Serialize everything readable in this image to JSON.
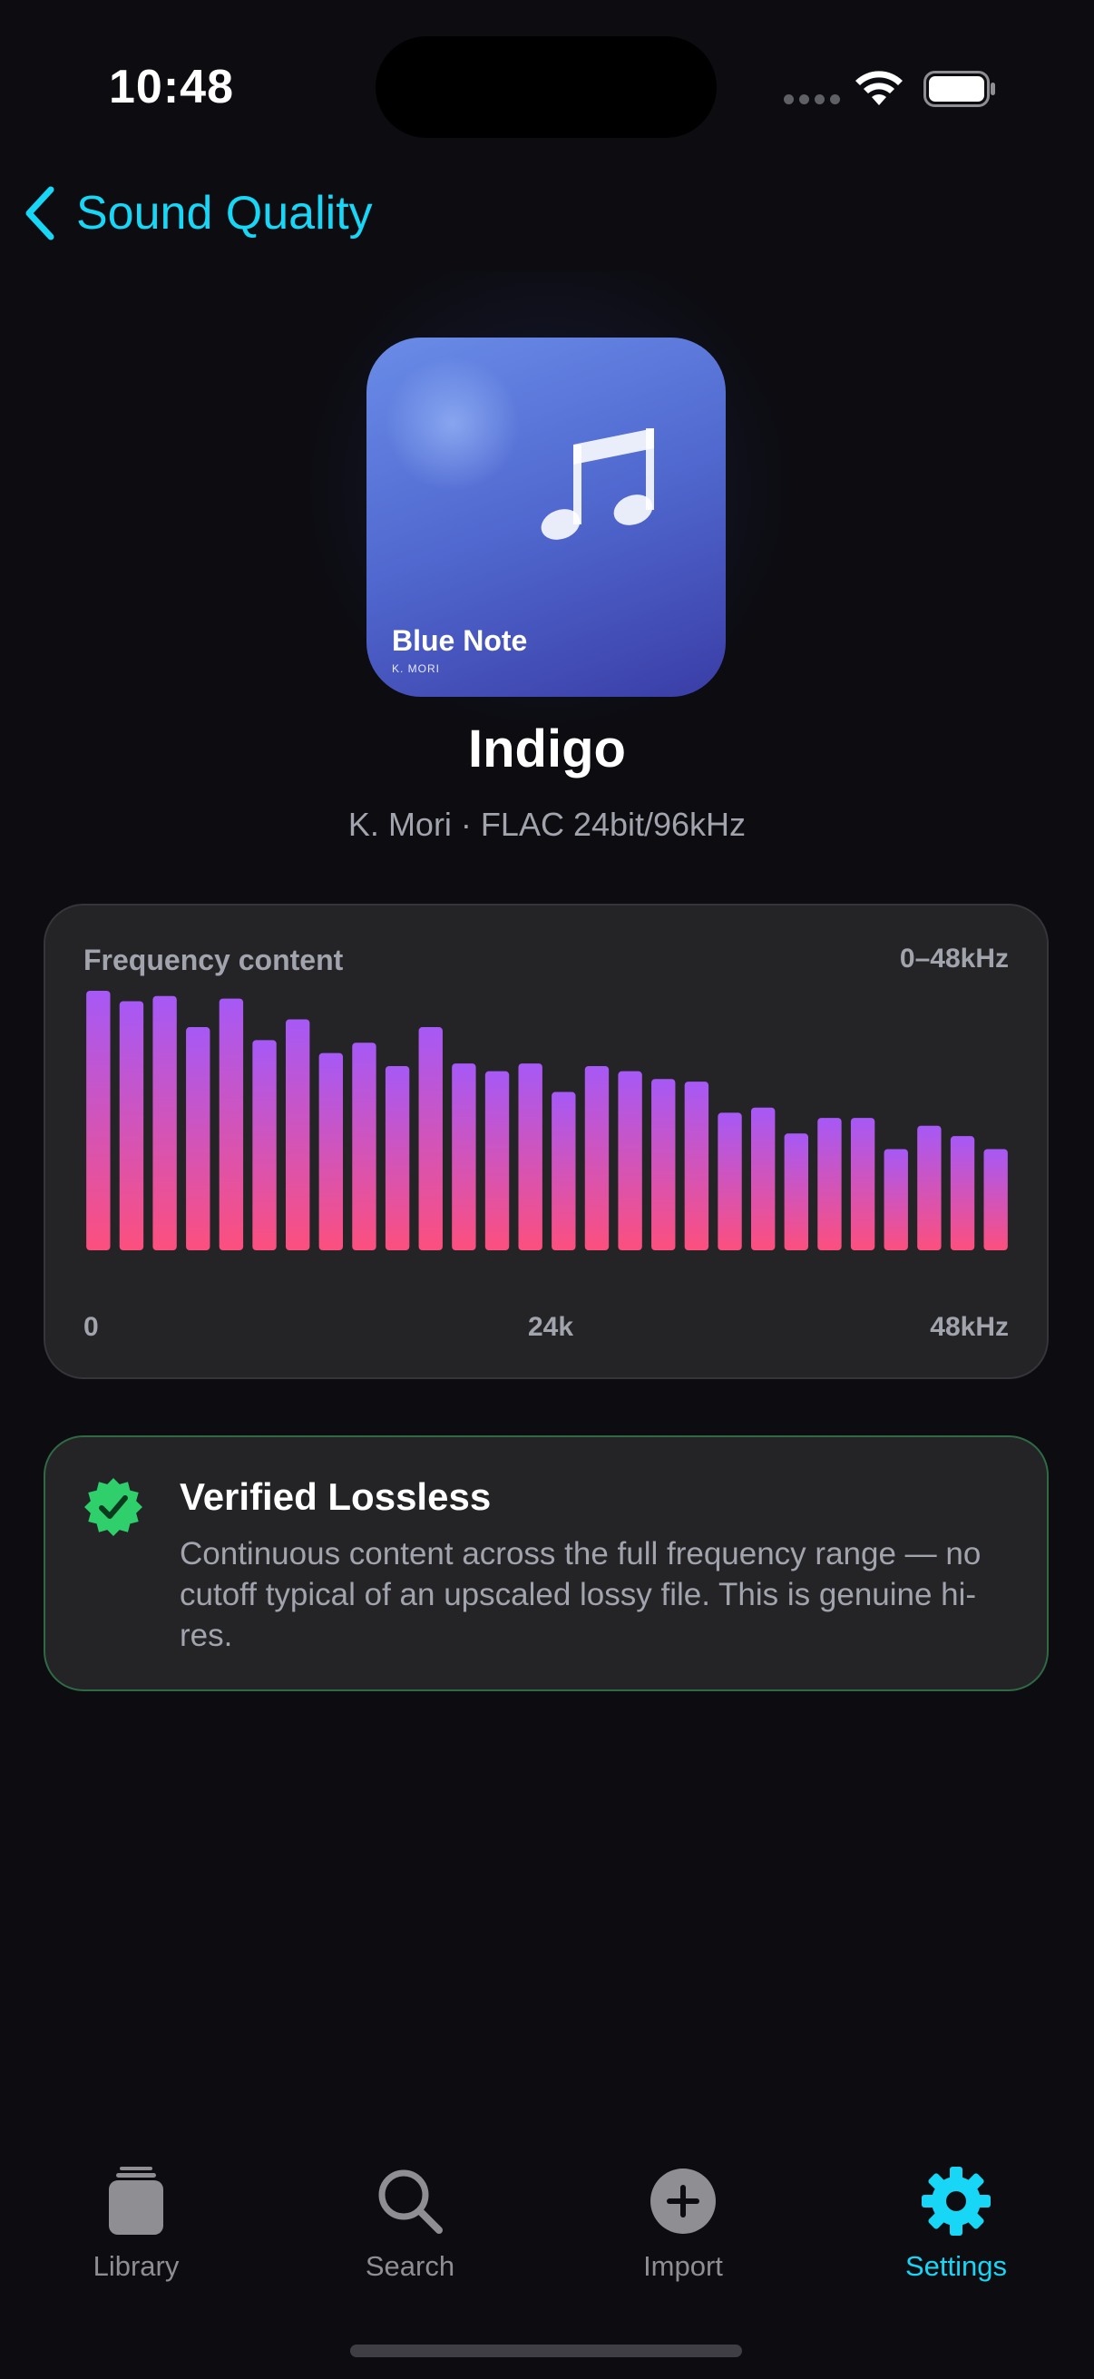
{
  "status_bar": {
    "time": "10:48"
  },
  "nav": {
    "back_label": "Sound Quality"
  },
  "album": {
    "art_title": "Blue Note",
    "art_artist": "K. MORI"
  },
  "track": {
    "title": "Indigo",
    "subtitle": "K. Mori · FLAC 24bit/96kHz"
  },
  "frequency": {
    "title": "Frequency content",
    "range_label": "0–48kHz",
    "axis_labels": [
      "0",
      "24k",
      "48kHz"
    ]
  },
  "chart_data": {
    "type": "bar",
    "title": "Frequency content",
    "x_range_label": "0–48kHz",
    "tick_labels": [
      "0",
      "24k",
      "48kHz"
    ],
    "values": [
      1.0,
      0.96,
      0.98,
      0.86,
      0.97,
      0.81,
      0.89,
      0.76,
      0.8,
      0.71,
      0.86,
      0.72,
      0.69,
      0.72,
      0.61,
      0.71,
      0.69,
      0.66,
      0.65,
      0.53,
      0.55,
      0.45,
      0.51,
      0.51,
      0.39,
      0.48,
      0.44,
      0.39
    ],
    "ylim": [
      0,
      1
    ],
    "grid": false,
    "colors": {
      "top": "#a659f6",
      "bottom": "#fc4f7e"
    }
  },
  "verification": {
    "title": "Verified Lossless",
    "body": "Continuous content across the full frequency range — no cutoff typical of an upscaled lossy file. This is genuine hi-res.",
    "color": "#2fcf6b"
  },
  "tabs": [
    {
      "label": "Library",
      "icon": "library-icon",
      "active": false
    },
    {
      "label": "Search",
      "icon": "search-icon",
      "active": false
    },
    {
      "label": "Import",
      "icon": "plus-circle-icon",
      "active": false
    },
    {
      "label": "Settings",
      "icon": "gear-icon",
      "active": true
    }
  ],
  "colors": {
    "accent": "#18d6f5",
    "background": "#0c0c11",
    "card": "#242427",
    "success": "#2fcf6b"
  }
}
